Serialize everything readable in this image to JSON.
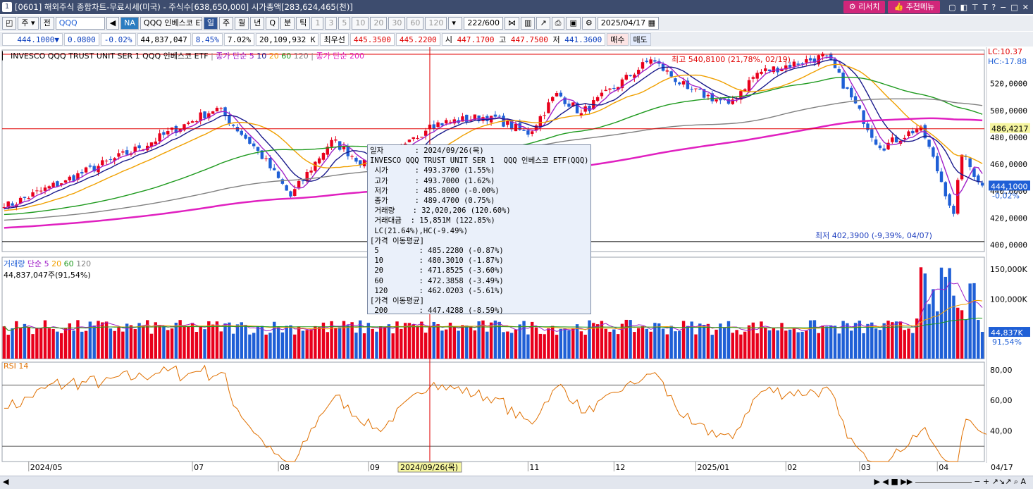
{
  "window": {
    "number": "1",
    "title": "[0601] 해외주식 종합차트-무료시세(미국) - 주식수[638,650,000] 시가총액[283,624,465(천)]",
    "research_btn": "리서치",
    "recommend_btn": "추천메뉴"
  },
  "toolbar": {
    "type_sel": "주",
    "all": "전",
    "code": "QQQ",
    "market_badge": "NA",
    "name": "QQQ 인베스코 ETF",
    "periods": [
      "일",
      "주",
      "월",
      "년",
      "Q",
      "분",
      "틱"
    ],
    "intervals": [
      "1",
      "3",
      "5",
      "10",
      "20",
      "30",
      "60",
      "120"
    ],
    "count": "222",
    "count_max": "/600",
    "date": "2025/04/17"
  },
  "quote": {
    "price": "444.1000▼",
    "change": "0.0800",
    "change_pct": "-0.02%",
    "volume": "44,837,047",
    "turnover": "8.45%",
    "vol_ratio": "7.02%",
    "amount": "20,109,932 K",
    "best_label": "최우선",
    "ask": "445.3500",
    "bid": "445.2200",
    "open_label": "시",
    "open": "447.1700",
    "high_label": "고",
    "high": "447.7500",
    "low_label": "저",
    "low": "441.3600",
    "buy": "매수",
    "sell": "매도"
  },
  "legend": {
    "instrument": "INVESCO QQQ TRUST UNIT SER 1  QQQ 인베스코 ETF",
    "ma_label": "종가 단순 5",
    "ma10": "10",
    "ma20": "20",
    "ma60": "60",
    "ma120": "120",
    "ma200_label": "종가 단순 200",
    "lc": "LC:10.37",
    "hc": "HC:-17.88"
  },
  "volume_legend": {
    "label": "거래량",
    "ma_label": "단순 5",
    "ma20": "20",
    "ma60": "60",
    "ma120": "120",
    "value": "44,837,047주(91,54%)"
  },
  "rsi_legend": "RSI 14",
  "annotations": {
    "high": "최고 540,8100 (21,78%, 02/19)",
    "low": "최저 402,3900 (-9,39%, 04/07)"
  },
  "axis_labels": {
    "price_ticks": [
      "520,0000",
      "500,0000",
      "480,0000",
      "460,0000",
      "440,0000",
      "420,0000",
      "400,0000"
    ],
    "current_price": "444,1000",
    "current_pct": "-0,02%",
    "hline_price": "486,4217",
    "volume_ticks": [
      "150,000K",
      "100,000K"
    ],
    "current_volume": "44,837K",
    "current_vol_pct": "91,54%",
    "rsi_ticks": [
      "80,00",
      "60,00",
      "40,00"
    ],
    "dates": [
      "2024/05",
      "07",
      "08",
      "09",
      "11",
      "12",
      "2025/01",
      "02",
      "03",
      "04",
      "04/17"
    ],
    "cursor_date": "2024/09/26(목)"
  },
  "tooltip": [
    "일자       : 2024/09/26(목)",
    "INVESCO QQQ TRUST UNIT SER 1  QQQ 인베스코 ETF(QQQ)",
    " 시가      : 493.3700 (1.55%)",
    " 고가      : 493.7000 (1.62%)",
    " 저가      : 485.8000 (-0.00%)",
    " 종가      : 489.4700 (0.75%)",
    " 거래량    : 32,020,206 (120.60%)",
    " 거래대금  : 15,851M (122.85%)",
    " LC(21.64%),HC(-9.49%)",
    "[가격 이동평균]",
    " 5         : 485.2280 (-0.87%)",
    " 10        : 480.3010 (-1.87%)",
    " 20        : 471.8525 (-3.60%)",
    " 60        : 472.3858 (-3.49%)",
    " 120       : 462.0203 (-5.61%)",
    "[가격 이동평균]",
    " 200       : 447.4288 (-8.59%)"
  ],
  "colors": {
    "up": "#e8001c",
    "down": "#1f5fd6",
    "ma5": "#1a1a8c",
    "ma10": "#a020c8",
    "ma20": "#f0a000",
    "ma60": "#1e9a1e",
    "ma120": "#808080",
    "ma200": "#e020c0",
    "rsi": "#e07000"
  },
  "chart_data": {
    "type": "candlestick",
    "y_range": [
      395,
      545
    ],
    "volume_range": [
      0,
      170000000
    ],
    "rsi_range": [
      20,
      85
    ],
    "anchors": [
      {
        "date": "2024-04-22",
        "close": 428
      },
      {
        "date": "2024-05-15",
        "close": 448
      },
      {
        "date": "2024-06-10",
        "close": 472
      },
      {
        "date": "2024-07-10",
        "close": 502
      },
      {
        "date": "2024-07-25",
        "close": 470
      },
      {
        "date": "2024-08-05",
        "close": 436
      },
      {
        "date": "2024-08-20",
        "close": 478
      },
      {
        "date": "2024-09-06",
        "close": 453
      },
      {
        "date": "2024-09-26",
        "close": 489.47
      },
      {
        "date": "2024-10-18",
        "close": 496
      },
      {
        "date": "2024-11-01",
        "close": 482
      },
      {
        "date": "2024-11-11",
        "close": 513
      },
      {
        "date": "2024-11-20",
        "close": 498
      },
      {
        "date": "2024-12-16",
        "close": 538
      },
      {
        "date": "2024-12-30",
        "close": 516
      },
      {
        "date": "2025-01-13",
        "close": 505
      },
      {
        "date": "2025-01-24",
        "close": 528
      },
      {
        "date": "2025-02-19",
        "close": 540.81
      },
      {
        "date": "2025-03-10",
        "close": 472
      },
      {
        "date": "2025-03-25",
        "close": 488
      },
      {
        "date": "2025-04-07",
        "close": 423
      },
      {
        "date": "2025-04-09",
        "close": 467
      },
      {
        "date": "2025-04-17",
        "close": 444.1
      }
    ],
    "last_close": 444.1,
    "high_close": 540.81,
    "low_close": 402.39,
    "hline": 486.4217,
    "rsi_levels": [
      70,
      30
    ]
  }
}
